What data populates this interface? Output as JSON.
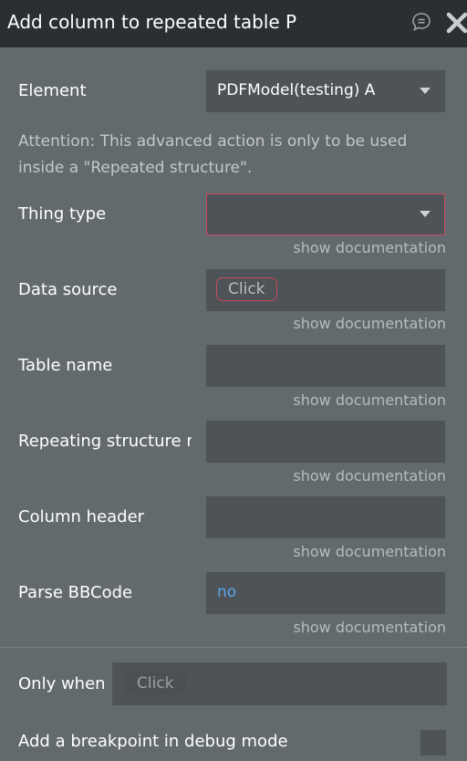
{
  "header": {
    "title": "Add column to repeated table P"
  },
  "fields": {
    "element": {
      "label": "Element",
      "value": "PDFModel(testing) A"
    },
    "attention": "Attention: This advanced action is only to be used inside a \"Repeated structure\".",
    "thing_type": {
      "label": "Thing type",
      "value": "",
      "doc": "show documentation"
    },
    "data_source": {
      "label": "Data source",
      "button": "Click",
      "doc": "show documentation"
    },
    "table_name": {
      "label": "Table name",
      "value": "",
      "doc": "show documentation"
    },
    "repeating_structure": {
      "label": "Repeating structure n",
      "value": "",
      "doc": "show documentation"
    },
    "column_header": {
      "label": "Column header",
      "value": "",
      "doc": "show documentation"
    },
    "parse_bbcode": {
      "label": "Parse BBCode",
      "value": "no",
      "doc": "show documentation"
    }
  },
  "conditions": {
    "only_when_label": "Only when",
    "only_when_button": "Click",
    "breakpoint_label": "Add a breakpoint in debug mode"
  },
  "colors": {
    "panel": "#636a6d",
    "titlebar": "#2a2f32",
    "field": "#4d5356",
    "error": "#c94b5e",
    "link": "#5aa5e8"
  }
}
